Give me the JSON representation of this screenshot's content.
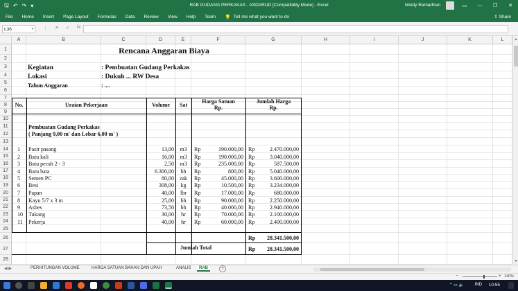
{
  "titlebar": {
    "title": "RAB GUDANG PERKAKAS - ASDARUD  [Compatibility Mode]  -  Excel",
    "user": "Moldy Ramadhan",
    "save_glyph": "🖫",
    "undo_glyph": "↶",
    "redo_glyph": "↷",
    "qa_more_glyph": "▾",
    "minimize_glyph": "—",
    "restore_glyph": "❐",
    "close_glyph": "✕",
    "ribbon_display_glyph": "▭"
  },
  "ribbon": {
    "tabs": [
      "File",
      "Home",
      "Insert",
      "Page Layout",
      "Formulas",
      "Data",
      "Review",
      "View",
      "Help",
      "Team"
    ],
    "tellme_glyph": "💡",
    "tellme": "Tell me what you want to do",
    "share": "Share",
    "share_glyph": "⇪"
  },
  "formula_bar": {
    "name_box": "L36",
    "name_dd": "▾",
    "more": "⋮",
    "cancel": "✕",
    "enter": "✓",
    "fx": "fx",
    "value": ""
  },
  "columns": [
    "A",
    "B",
    "C",
    "D",
    "E",
    "F",
    "G",
    "H",
    "I",
    "J",
    "K",
    "L"
  ],
  "rows": [
    "1",
    "2",
    "3",
    "4",
    "5",
    "6",
    "7",
    "8",
    "9",
    "10",
    "11",
    "12",
    "13",
    "14",
    "15",
    "16",
    "17",
    "18",
    "19",
    "20",
    "21",
    "22",
    "23",
    "24",
    "25",
    "26",
    "27",
    "28"
  ],
  "sheet": {
    "title": "Rencana Anggaran Biaya",
    "kegiatan_label": "Kegiatan",
    "kegiatan_value": ": Pembuatan Gudang Perkakas",
    "lokasi_label": "Lokasi",
    "lokasi_value": ": Dukuh ... RW Desa",
    "tahun_label": "Tahun Anggaran",
    "tahun_value": ": ....",
    "headers": {
      "no": "No.",
      "uraian": "Uraian Pekerjaan",
      "volume": "Volume",
      "sat": "Sat",
      "harga_satuan_1": "Harga Satuan",
      "harga_satuan_2": "Rp.",
      "jumlah_1": "Jumlah Harga",
      "jumlah_2": "Rp."
    },
    "section_title": "Pembuatan Gudang Perkakas",
    "section_sub": "( Panjang 9,00 m' dan Lebar 6,00 m' )",
    "currency": "Rp",
    "items": [
      {
        "no": "1",
        "name": "Pasir pasang",
        "vol": "13,00",
        "sat": "m3",
        "price": "190.000,00",
        "total": "2.470.000,00"
      },
      {
        "no": "2",
        "name": "Batu kali",
        "vol": "16,00",
        "sat": "m3",
        "price": "190.000,00",
        "total": "3.040.000,00"
      },
      {
        "no": "3",
        "name": "Batu pecah 2 - 3",
        "vol": "2,50",
        "sat": "m3",
        "price": "235.000,00",
        "total": "587.500,00"
      },
      {
        "no": "4",
        "name": "Batu bata",
        "vol": "6.300,00",
        "sat": "bh",
        "price": "800,00",
        "total": "5.040.000,00"
      },
      {
        "no": "5",
        "name": "Semen PC",
        "vol": "80,00",
        "sat": "zak",
        "price": "45.000,00",
        "total": "3.600.000,00"
      },
      {
        "no": "6",
        "name": "Besi",
        "vol": "308,00",
        "sat": "kg",
        "price": "10.500,00",
        "total": "3.234.000,00"
      },
      {
        "no": "7",
        "name": "Papan",
        "vol": "40,00",
        "sat": "lbr",
        "price": "17.000,00",
        "total": "680.000,00"
      },
      {
        "no": "8",
        "name": "Kayu 5/7 x 3 m",
        "vol": "25,00",
        "sat": "bh",
        "price": "90.000,00",
        "total": "2.250.000,00"
      },
      {
        "no": "9",
        "name": "Asbes",
        "vol": "73,50",
        "sat": "bh",
        "price": "40.000,00",
        "total": "2.940.000,00"
      },
      {
        "no": "10",
        "name": "Tukang",
        "vol": "30,00",
        "sat": "hr",
        "price": "70.000,00",
        "total": "2.100.000,00"
      },
      {
        "no": "11",
        "name": "Pekerja",
        "vol": "40,00",
        "sat": "hr",
        "price": "60.000,00",
        "total": "2.400.000,00"
      }
    ],
    "subtotal": "28.341.500,00",
    "jumlah_total_label": "Jumlah Total",
    "jumlah_total": "28.341.500,00"
  },
  "scroll": {
    "up": "▲",
    "down": "▼"
  },
  "sheet_tabs": {
    "nav": "◀ ▶",
    "tabs": [
      "PERHITUNGAN VOLUME",
      "HARGA SATUAN BAHAN DAN UPAH",
      "ANALIS",
      "RAB"
    ],
    "active": "RAB",
    "add": "+"
  },
  "statusbar": {
    "zoom": "140%",
    "zoom_minus": "−",
    "zoom_plus": "+"
  },
  "taskbar": {
    "time": "10:55",
    "lang": "IND",
    "tray_glyphs": "⌃ ▭ 🔈"
  }
}
